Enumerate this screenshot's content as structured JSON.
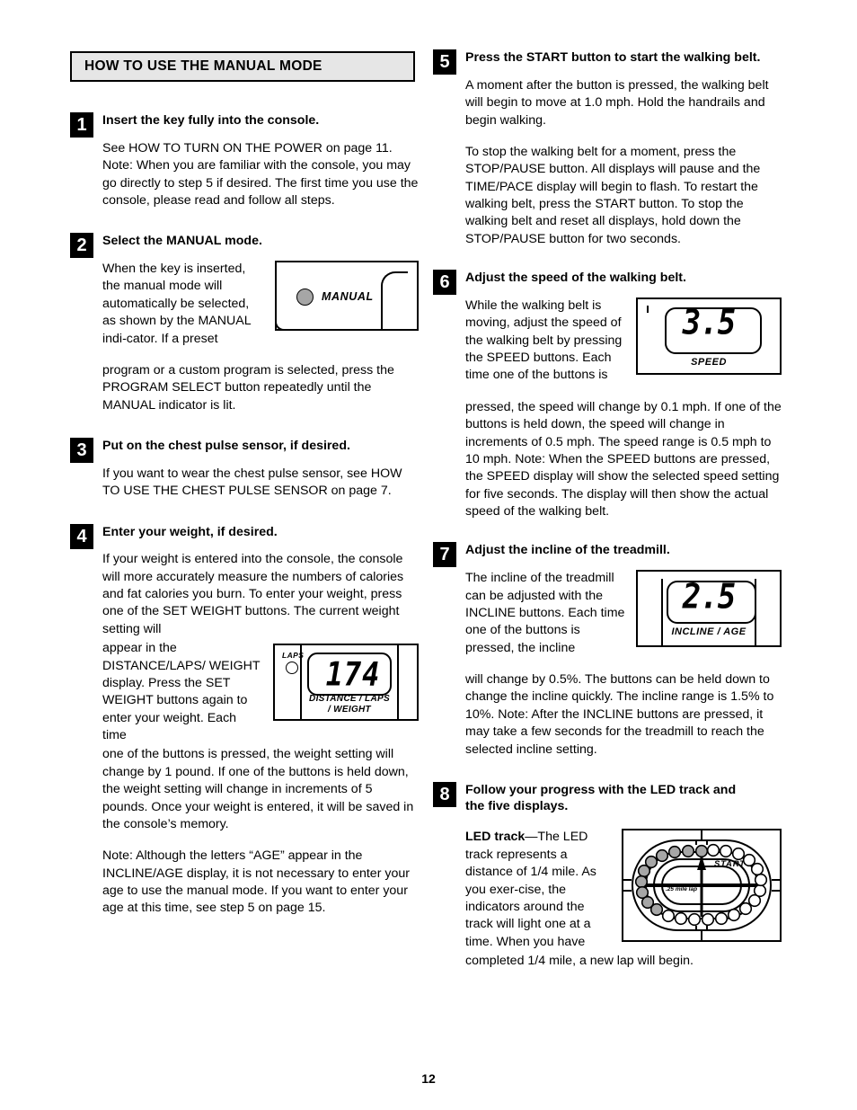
{
  "page": {
    "number": "12",
    "section_header": "HOW TO USE THE MANUAL MODE"
  },
  "steps": [
    {
      "number": "1",
      "title": "Insert the key fully into the console.",
      "paragraphs": [
        "See HOW TO TURN ON THE POWER on page 11. Note: When you are familiar with the console, you may go directly to step 5 if desired. The first time you use the console, please read and follow all steps."
      ]
    },
    {
      "number": "2",
      "title": "Select the MANUAL mode.",
      "paragraphs": [
        "When the key is inserted, the manual mode will automatically be selected, as shown by the MANUAL indi-cator. If a preset",
        "program or a custom program is selected, press the PROGRAM SELECT button repeatedly until the MANUAL indicator is lit."
      ]
    },
    {
      "number": "3",
      "title": "Put on the chest pulse sensor, if desired.",
      "paragraphs": [
        "If you want to wear the chest pulse sensor, see HOW TO USE THE CHEST PULSE SENSOR on page 7."
      ]
    },
    {
      "number": "4",
      "title": "Enter your weight, if desired.",
      "paragraphs": [
        "If your weight is entered into the console, the console will more accurately measure the numbers of calories and fat calories you burn. To enter your weight, press one of the SET WEIGHT buttons. The current weight setting will",
        "appear in the DISTANCE/LAPS/ WEIGHT display. Press the SET WEIGHT buttons again to enter your weight. Each time",
        "one of the buttons is pressed, the weight setting will change by 1 pound. If one of the buttons is held down, the weight setting will change in increments of 5 pounds. Once your weight is entered, it will be saved in the console’s memory.",
        "Note: Although the letters “AGE” appear in the INCLINE/AGE display, it is not necessary to enter your age to use the manual mode. If you want to enter your age at this time, see step 5 on page 15."
      ]
    },
    {
      "number": "5",
      "title": "Press the START button to start the walking belt.",
      "paragraphs": [
        "A moment after the button is pressed, the walking belt will begin to move at 1.0 mph. Hold the handrails and begin walking.",
        "To stop the walking belt for a moment, press the STOP/PAUSE button. All displays will pause and the TIME/PACE display will begin to flash. To restart the walking belt, press the START button. To stop the walking belt and reset all displays, hold down the STOP/PAUSE button for two seconds."
      ]
    },
    {
      "number": "6",
      "title": "Adjust the speed of the walking belt.",
      "paragraphs": [
        "While the walking belt is moving, adjust the speed of the walking belt by pressing the SPEED buttons. Each time one of the buttons is",
        "pressed, the speed will change by 0.1 mph. If one of the buttons is held down, the speed will change in increments of 0.5 mph. The speed range is 0.5 mph to 10 mph. Note: When the SPEED buttons are pressed, the SPEED display will show the selected speed setting for five seconds. The display will then show the actual speed of the walking belt."
      ]
    },
    {
      "number": "7",
      "title": "Adjust the incline of the treadmill.",
      "paragraphs": [
        "The incline of the treadmill can be adjusted with the INCLINE buttons. Each time one of the buttons is pressed, the incline",
        "will change by 0.5%. The buttons can be held down to change the incline quickly. The incline range is 1.5% to 10%. Note: After the INCLINE buttons are pressed, it may take a few seconds for the treadmill to reach the selected incline setting."
      ]
    },
    {
      "number": "8",
      "title_line1": "Follow your progress with the LED track and",
      "title_line2": "the five displays.",
      "led_lead_bold": "LED track",
      "led_body_1": "—The LED track represents a distance of 1/4 mile. As you exer-cise, the indicators around the track will light one at a time. When you have",
      "led_body_2": "completed 1/4 mile, a new lap will begin."
    }
  ],
  "figures": {
    "manual_indicator": {
      "label": "MANUAL",
      "indicator_color": "#a6a6a6",
      "indicator_state": "lit"
    },
    "distance_laps_weight_display": {
      "value": "174",
      "caption_line1": "DISTANCE / LAPS",
      "caption_line2": "/ WEIGHT",
      "laps_label": "LAPS"
    },
    "speed_display": {
      "value": "3.5",
      "caption": "SPEED"
    },
    "incline_age_display": {
      "value": "2.5",
      "caption": "INCLINE / AGE"
    },
    "led_track": {
      "start_label": "START",
      "lap_label": ".25 mile lap",
      "total_leds": 24,
      "lit_leds": 10,
      "lit_color": "#a6a6a6",
      "unlit_color": "#ffffff"
    }
  }
}
